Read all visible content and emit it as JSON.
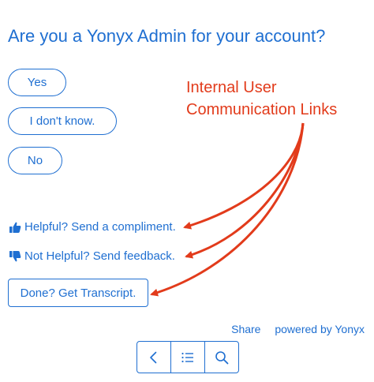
{
  "question": "Are you a Yonyx Admin for your account?",
  "choices": [
    {
      "label": "Yes"
    },
    {
      "label": "I don't know."
    },
    {
      "label": "No"
    }
  ],
  "annotation": {
    "line1": "Internal User",
    "line2": "Communication Links",
    "color": "#e23b1b"
  },
  "links": {
    "helpful": {
      "label": "Helpful? Send a compliment.",
      "icon": "thumbs-up-icon"
    },
    "not_helpful": {
      "label": "Not Helpful? Send feedback.",
      "icon": "thumbs-down-icon"
    }
  },
  "transcript_button": "Done? Get Transcript.",
  "footer": {
    "share": "Share",
    "powered_by": "powered by Yonyx"
  },
  "navbar": {
    "back_icon": "chevron-left-icon",
    "list_icon": "list-icon",
    "search_icon": "search-icon"
  },
  "colors": {
    "accent": "#1f6fd1",
    "annotation": "#e23b1b"
  }
}
